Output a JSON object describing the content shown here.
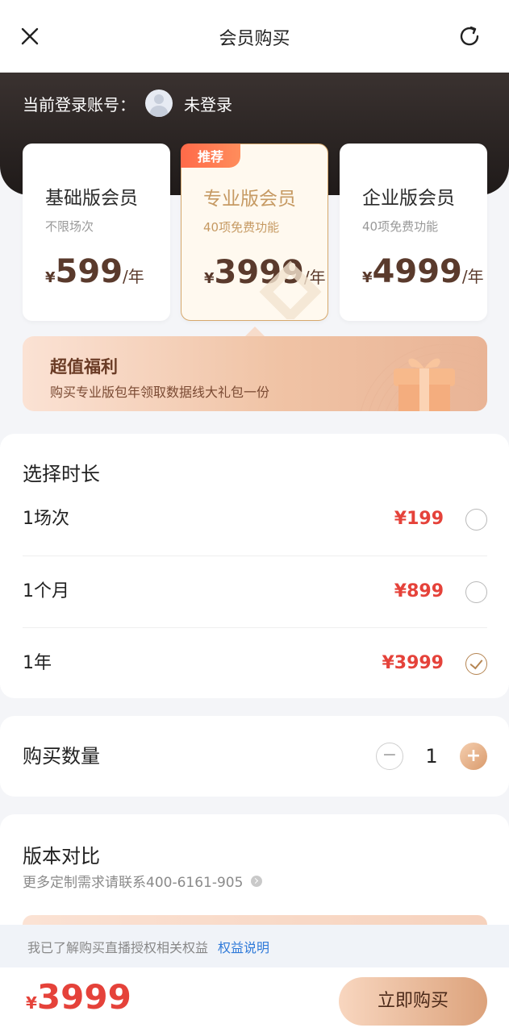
{
  "header": {
    "title": "会员购买",
    "close_icon": "close-icon",
    "refresh_icon": "refresh-icon"
  },
  "account": {
    "label": "当前登录账号：",
    "status": "未登录"
  },
  "plans": [
    {
      "name": "基础版会员",
      "subtitle": "不限场次",
      "currency": "¥",
      "price": "599",
      "unit": "/年"
    },
    {
      "name": "专业版会员",
      "subtitle": "40项免费功能",
      "currency": "¥",
      "price": "3999",
      "unit": "/年",
      "badge": "推荐"
    },
    {
      "name": "企业版会员",
      "subtitle": "40项免费功能",
      "currency": "¥",
      "price": "4999",
      "unit": "/年"
    }
  ],
  "benefit": {
    "title": "超值福利",
    "subtitle": "购买专业版包年领取数据线大礼包一份"
  },
  "duration": {
    "title": "选择时长",
    "options": [
      {
        "label": "1场次",
        "price": "¥199",
        "selected": false
      },
      {
        "label": "1个月",
        "price": "¥899",
        "selected": false
      },
      {
        "label": "1年",
        "price": "¥3999",
        "selected": true
      }
    ]
  },
  "quantity": {
    "label": "购买数量",
    "value": "1",
    "minus": "−",
    "plus": "+"
  },
  "compare": {
    "title": "版本对比",
    "subtitle": "更多定制需求请联系400-6161-905"
  },
  "agreement": {
    "text": "我已了解购买直播授权相关权益",
    "link": "权益说明"
  },
  "footer": {
    "currency": "¥",
    "total": "3999",
    "buy_label": "立即购买"
  },
  "colors": {
    "accent_red": "#e5423a",
    "gold": "#c69a63",
    "dark_band": "#2a2322",
    "link_blue": "#2f7ad9"
  }
}
